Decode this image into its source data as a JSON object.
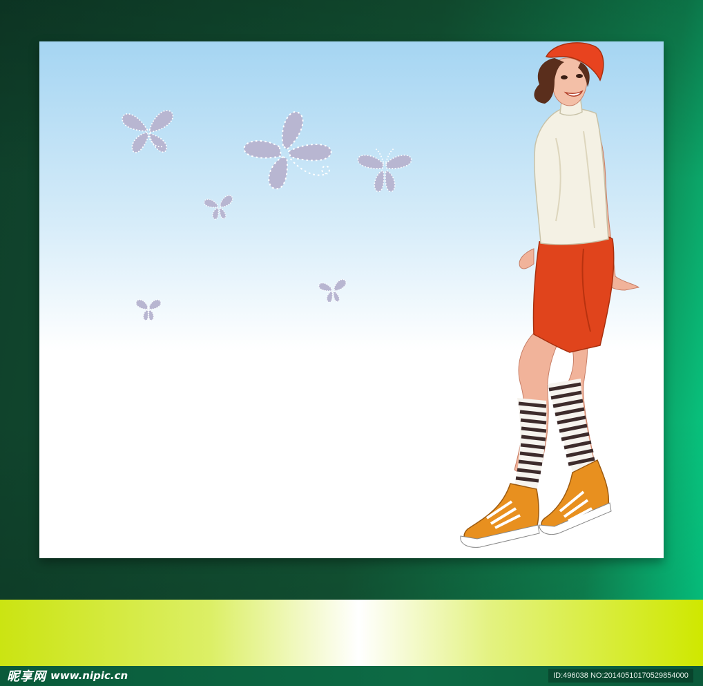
{
  "footer": {
    "logo_text": "昵享网",
    "site_url": "www.nipic.cn",
    "image_id": "ID:496038 NO:20140510170529854000"
  },
  "colors": {
    "frame": "#135736",
    "frame_edge": "#06d48a",
    "sky_top": "#a5d5f2",
    "canvas_bottom": "#ffffff",
    "band": "#cfe800",
    "footer_bar": "#0d6b45",
    "butterfly": "#b8b6d1",
    "beret": "#e8431f",
    "skirt": "#e0441c",
    "top": "#f4f1e4",
    "sneakers": "#e8901f",
    "socks_stripe": "#3d2b2b"
  },
  "scene": {
    "icons": [
      "butterfly-icon",
      "woman-illustration"
    ]
  }
}
